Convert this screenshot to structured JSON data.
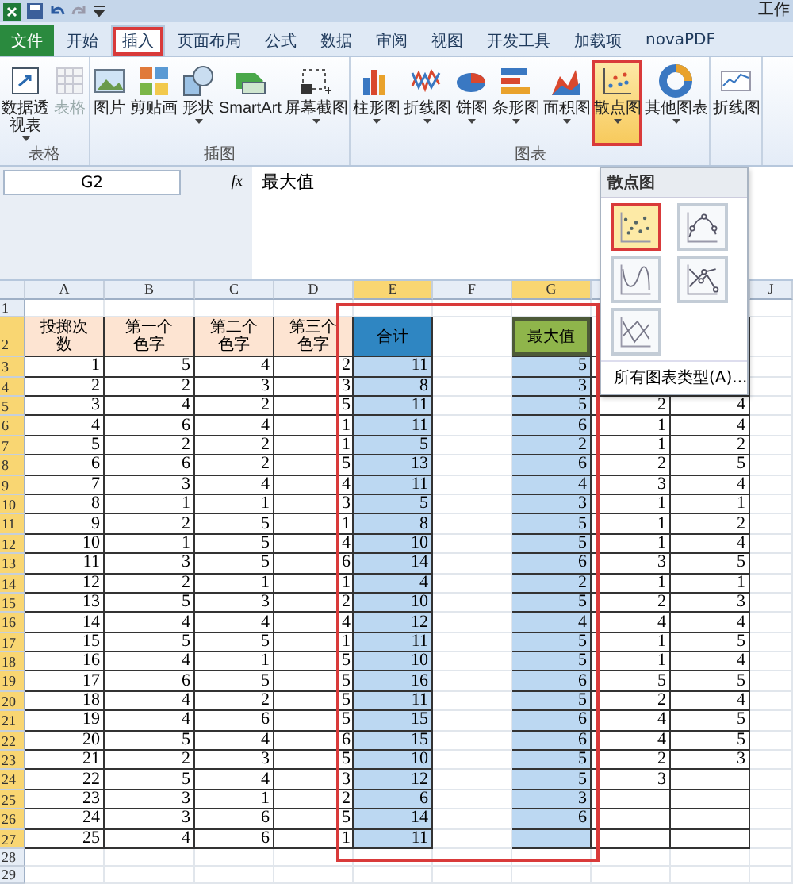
{
  "window": {
    "title": "工作"
  },
  "tabs": [
    {
      "label": "文件",
      "kind": "file",
      "selected": false,
      "outlined": false
    },
    {
      "label": "开始",
      "kind": "tab",
      "selected": false,
      "outlined": false
    },
    {
      "label": "插入",
      "kind": "tab",
      "selected": true,
      "outlined": true
    },
    {
      "label": "页面布局",
      "kind": "tab",
      "selected": false,
      "outlined": false
    },
    {
      "label": "公式",
      "kind": "tab",
      "selected": false,
      "outlined": false
    },
    {
      "label": "数据",
      "kind": "tab",
      "selected": false,
      "outlined": false
    },
    {
      "label": "审阅",
      "kind": "tab",
      "selected": false,
      "outlined": false
    },
    {
      "label": "视图",
      "kind": "tab",
      "selected": false,
      "outlined": false
    },
    {
      "label": "开发工具",
      "kind": "tab",
      "selected": false,
      "outlined": false
    },
    {
      "label": "加载项",
      "kind": "tab",
      "selected": false,
      "outlined": false
    },
    {
      "label": "novaPDF",
      "kind": "tab",
      "selected": false,
      "outlined": false
    }
  ],
  "ribbon": {
    "groups": [
      {
        "label": "表格",
        "buttons": [
          {
            "label": "数据透视表",
            "kind": "pivot",
            "has_menu": true,
            "disabled": false,
            "selected": false
          },
          {
            "label": "表格",
            "kind": "table",
            "has_menu": false,
            "disabled": true,
            "selected": false
          }
        ]
      },
      {
        "label": "插图",
        "buttons": [
          {
            "label": "图片",
            "kind": "picture",
            "has_menu": false,
            "disabled": false,
            "selected": false
          },
          {
            "label": "剪贴画",
            "kind": "clipart",
            "has_menu": false,
            "disabled": false,
            "selected": false
          },
          {
            "label": "形状",
            "kind": "shapes",
            "has_menu": true,
            "disabled": false,
            "selected": false
          },
          {
            "label": "SmartArt",
            "kind": "smartart",
            "has_menu": false,
            "disabled": false,
            "selected": false
          },
          {
            "label": "屏幕截图",
            "kind": "screenshot",
            "has_menu": true,
            "disabled": false,
            "selected": false
          }
        ]
      },
      {
        "label": "图表",
        "buttons": [
          {
            "label": "柱形图",
            "kind": "column",
            "has_menu": true,
            "disabled": false,
            "selected": false
          },
          {
            "label": "折线图",
            "kind": "line",
            "has_menu": true,
            "disabled": false,
            "selected": false
          },
          {
            "label": "饼图",
            "kind": "pie",
            "has_menu": true,
            "disabled": false,
            "selected": false
          },
          {
            "label": "条形图",
            "kind": "bar",
            "has_menu": true,
            "disabled": false,
            "selected": false
          },
          {
            "label": "面积图",
            "kind": "area",
            "has_menu": true,
            "disabled": false,
            "selected": false
          },
          {
            "label": "散点图",
            "kind": "scatter",
            "has_menu": true,
            "disabled": false,
            "selected": true,
            "outlined": true
          },
          {
            "label": "其他图表",
            "kind": "donut",
            "has_menu": true,
            "disabled": false,
            "selected": false
          }
        ]
      },
      {
        "buttons": [
          {
            "label": "折线图",
            "kind": "sparkline",
            "has_menu": false,
            "disabled": false,
            "selected": false
          }
        ]
      }
    ]
  },
  "formula_bar": {
    "name_box": "G2",
    "fx": "fx",
    "value": "最大值"
  },
  "scatter_menu": {
    "title": "散点图",
    "items": [
      {
        "kind": "markers",
        "selected": true,
        "outlined": true
      },
      {
        "kind": "smooth_markers",
        "selected": false,
        "outlined": false
      },
      {
        "kind": "smooth",
        "selected": false,
        "outlined": false
      },
      {
        "kind": "straight_markers",
        "selected": false,
        "outlined": false
      },
      {
        "kind": "straight",
        "selected": false,
        "outlined": false
      }
    ],
    "footer": "所有图表类型(A)..."
  },
  "sheet": {
    "outlined_range": true,
    "columns": [
      {
        "label": "A",
        "kind": "plain",
        "selected": false
      },
      {
        "label": "B",
        "kind": "input",
        "selected": false
      },
      {
        "label": "C",
        "kind": "input",
        "selected": false
      },
      {
        "label": "D",
        "kind": "input",
        "selected": false
      },
      {
        "label": "E",
        "kind": "total",
        "selected": true
      },
      {
        "label": "F",
        "kind": "gap",
        "selected": false
      },
      {
        "label": "G",
        "kind": "max",
        "selected": true
      },
      {
        "kind": "extra",
        "selected": false
      },
      {
        "kind": "extra"
      },
      {
        "label": "J",
        "kind": "gap",
        "selected": false
      }
    ],
    "rows": [
      {
        "label": "1",
        "kind": "empty",
        "selected": false,
        "cells": []
      },
      {
        "label": "2",
        "kind": "header",
        "selected": true,
        "cells": [
          "投掷次数",
          "第一个色字",
          "第二个色字",
          "第三个色字",
          "合计",
          null,
          "最大值",
          null,
          null,
          null
        ]
      },
      {
        "label": "3",
        "kind": "data",
        "selected": true,
        "cells": [
          "1",
          "5",
          "4",
          "2",
          "11",
          null,
          "5",
          null,
          null,
          null
        ]
      },
      {
        "label": "4",
        "kind": "data",
        "selected": true,
        "cells": [
          "2",
          "2",
          "3",
          "3",
          "8",
          null,
          "3",
          null,
          null,
          null
        ]
      },
      {
        "label": "5",
        "kind": "data",
        "selected": true,
        "cells": [
          "3",
          "4",
          "2",
          "5",
          "11",
          null,
          "5",
          "2",
          "4",
          null
        ]
      },
      {
        "label": "6",
        "kind": "data",
        "selected": true,
        "cells": [
          "4",
          "6",
          "4",
          "1",
          "11",
          null,
          "6",
          "1",
          "4",
          null
        ]
      },
      {
        "label": "7",
        "kind": "data",
        "selected": true,
        "cells": [
          "5",
          "2",
          "2",
          "1",
          "5",
          null,
          "2",
          "1",
          "2",
          null
        ]
      },
      {
        "label": "8",
        "kind": "data",
        "selected": true,
        "cells": [
          "6",
          "6",
          "2",
          "5",
          "13",
          null,
          "6",
          "2",
          "5",
          null
        ]
      },
      {
        "label": "9",
        "kind": "data",
        "selected": true,
        "cells": [
          "7",
          "3",
          "4",
          "4",
          "11",
          null,
          "4",
          "3",
          "4",
          null
        ]
      },
      {
        "label": "10",
        "kind": "data",
        "selected": true,
        "cells": [
          "8",
          "1",
          "1",
          "3",
          "5",
          null,
          "3",
          "1",
          "1",
          null
        ]
      },
      {
        "label": "11",
        "kind": "data",
        "selected": true,
        "cells": [
          "9",
          "2",
          "5",
          "1",
          "8",
          null,
          "5",
          "1",
          "2",
          null
        ]
      },
      {
        "label": "12",
        "kind": "data",
        "selected": true,
        "cells": [
          "10",
          "1",
          "5",
          "4",
          "10",
          null,
          "5",
          "1",
          "4",
          null
        ]
      },
      {
        "label": "13",
        "kind": "data",
        "selected": true,
        "cells": [
          "11",
          "3",
          "5",
          "6",
          "14",
          null,
          "6",
          "3",
          "5",
          null
        ]
      },
      {
        "label": "14",
        "kind": "data",
        "selected": true,
        "cells": [
          "12",
          "2",
          "1",
          "1",
          "4",
          null,
          "2",
          "1",
          "1",
          null
        ]
      },
      {
        "label": "15",
        "kind": "data",
        "selected": true,
        "cells": [
          "13",
          "5",
          "3",
          "2",
          "10",
          null,
          "5",
          "2",
          "3",
          null
        ]
      },
      {
        "label": "16",
        "kind": "data",
        "selected": true,
        "cells": [
          "14",
          "4",
          "4",
          "4",
          "12",
          null,
          "4",
          "4",
          "4",
          null
        ]
      },
      {
        "label": "17",
        "kind": "data",
        "selected": true,
        "cells": [
          "15",
          "5",
          "5",
          "1",
          "11",
          null,
          "5",
          "1",
          "5",
          null
        ]
      },
      {
        "label": "18",
        "kind": "data",
        "selected": true,
        "cells": [
          "16",
          "4",
          "1",
          "5",
          "10",
          null,
          "5",
          "1",
          "4",
          null
        ]
      },
      {
        "label": "19",
        "kind": "data",
        "selected": true,
        "cells": [
          "17",
          "6",
          "5",
          "5",
          "16",
          null,
          "6",
          "5",
          "5",
          null
        ]
      },
      {
        "label": "20",
        "kind": "data",
        "selected": true,
        "cells": [
          "18",
          "4",
          "2",
          "5",
          "11",
          null,
          "5",
          "2",
          "4",
          null
        ]
      },
      {
        "label": "21",
        "kind": "data",
        "selected": true,
        "cells": [
          "19",
          "4",
          "6",
          "5",
          "15",
          null,
          "6",
          "4",
          "5",
          null
        ]
      },
      {
        "label": "22",
        "kind": "data",
        "selected": true,
        "cells": [
          "20",
          "5",
          "4",
          "6",
          "15",
          null,
          "6",
          "4",
          "5",
          null
        ]
      },
      {
        "label": "23",
        "kind": "data",
        "selected": true,
        "cells": [
          "21",
          "2",
          "3",
          "5",
          "10",
          null,
          "5",
          "2",
          "3",
          null
        ]
      },
      {
        "label": "24",
        "kind": "data",
        "selected": true,
        "cells": [
          "22",
          "5",
          "4",
          "3",
          "12",
          null,
          "5",
          "3",
          null,
          null
        ]
      },
      {
        "label": "25",
        "kind": "data",
        "selected": true,
        "cells": [
          "23",
          "3",
          "1",
          "2",
          "6",
          null,
          "3",
          null,
          null,
          null
        ]
      },
      {
        "label": "26",
        "kind": "data",
        "selected": true,
        "cells": [
          "24",
          "3",
          "6",
          "5",
          "14",
          null,
          "6",
          null,
          null,
          null
        ]
      },
      {
        "label": "27",
        "kind": "data",
        "selected": true,
        "cells": [
          "25",
          "4",
          "6",
          "1",
          "11",
          null,
          null,
          null,
          null,
          null
        ]
      },
      {
        "label": "28",
        "kind": "empty",
        "selected": false,
        "cells": []
      },
      {
        "label": "29",
        "kind": "empty",
        "selected": false,
        "cells": []
      }
    ]
  }
}
